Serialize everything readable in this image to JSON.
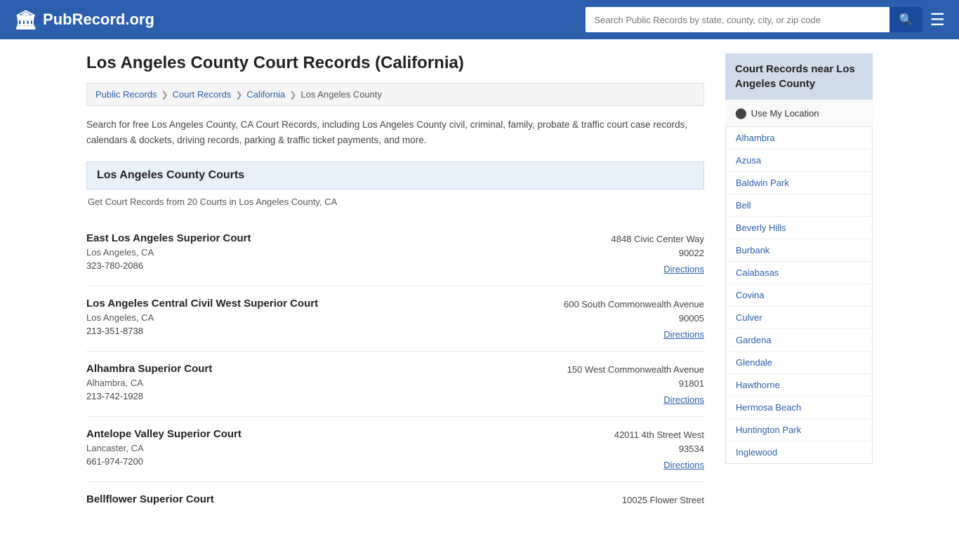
{
  "header": {
    "logo_icon": "🏛",
    "logo_text": "PubRecord.org",
    "search_placeholder": "Search Public Records by state, county, city, or zip code",
    "search_button_icon": "🔍"
  },
  "page": {
    "title": "Los Angeles County Court Records (California)",
    "description": "Search for free Los Angeles County, CA Court Records, including Los Angeles County civil, criminal, family, probate & traffic court case records, calendars & dockets, driving records, parking & traffic ticket payments, and more.",
    "breadcrumb": [
      {
        "label": "Public Records",
        "href": "#"
      },
      {
        "label": "Court Records",
        "href": "#"
      },
      {
        "label": "California",
        "href": "#"
      },
      {
        "label": "Los Angeles County",
        "current": true
      }
    ],
    "courts_section_header": "Los Angeles County Courts",
    "courts_section_sub": "Get Court Records from 20 Courts in Los Angeles County, CA",
    "courts": [
      {
        "name": "East Los Angeles Superior Court",
        "city": "Los Angeles, CA",
        "phone": "323-780-2086",
        "address_line1": "4848 Civic Center Way",
        "address_line2": "90022",
        "directions_label": "Directions"
      },
      {
        "name": "Los Angeles Central Civil West Superior Court",
        "city": "Los Angeles, CA",
        "phone": "213-351-8738",
        "address_line1": "600 South Commonwealth Avenue",
        "address_line2": "90005",
        "directions_label": "Directions"
      },
      {
        "name": "Alhambra Superior Court",
        "city": "Alhambra, CA",
        "phone": "213-742-1928",
        "address_line1": "150 West Commonwealth Avenue",
        "address_line2": "91801",
        "directions_label": "Directions"
      },
      {
        "name": "Antelope Valley Superior Court",
        "city": "Lancaster, CA",
        "phone": "661-974-7200",
        "address_line1": "42011 4th Street West",
        "address_line2": "93534",
        "directions_label": "Directions"
      },
      {
        "name": "Bellflower Superior Court",
        "city": "",
        "phone": "",
        "address_line1": "10025 Flower Street",
        "address_line2": "",
        "directions_label": ""
      }
    ]
  },
  "sidebar": {
    "header": "Court Records near Los Angeles County",
    "use_location_label": "Use My Location",
    "nearby_cities": [
      "Alhambra",
      "Azusa",
      "Baldwin Park",
      "Bell",
      "Beverly Hills",
      "Burbank",
      "Calabasas",
      "Covina",
      "Culver",
      "Gardena",
      "Glendale",
      "Hawthorne",
      "Hermosa Beach",
      "Huntington Park",
      "Inglewood"
    ]
  }
}
